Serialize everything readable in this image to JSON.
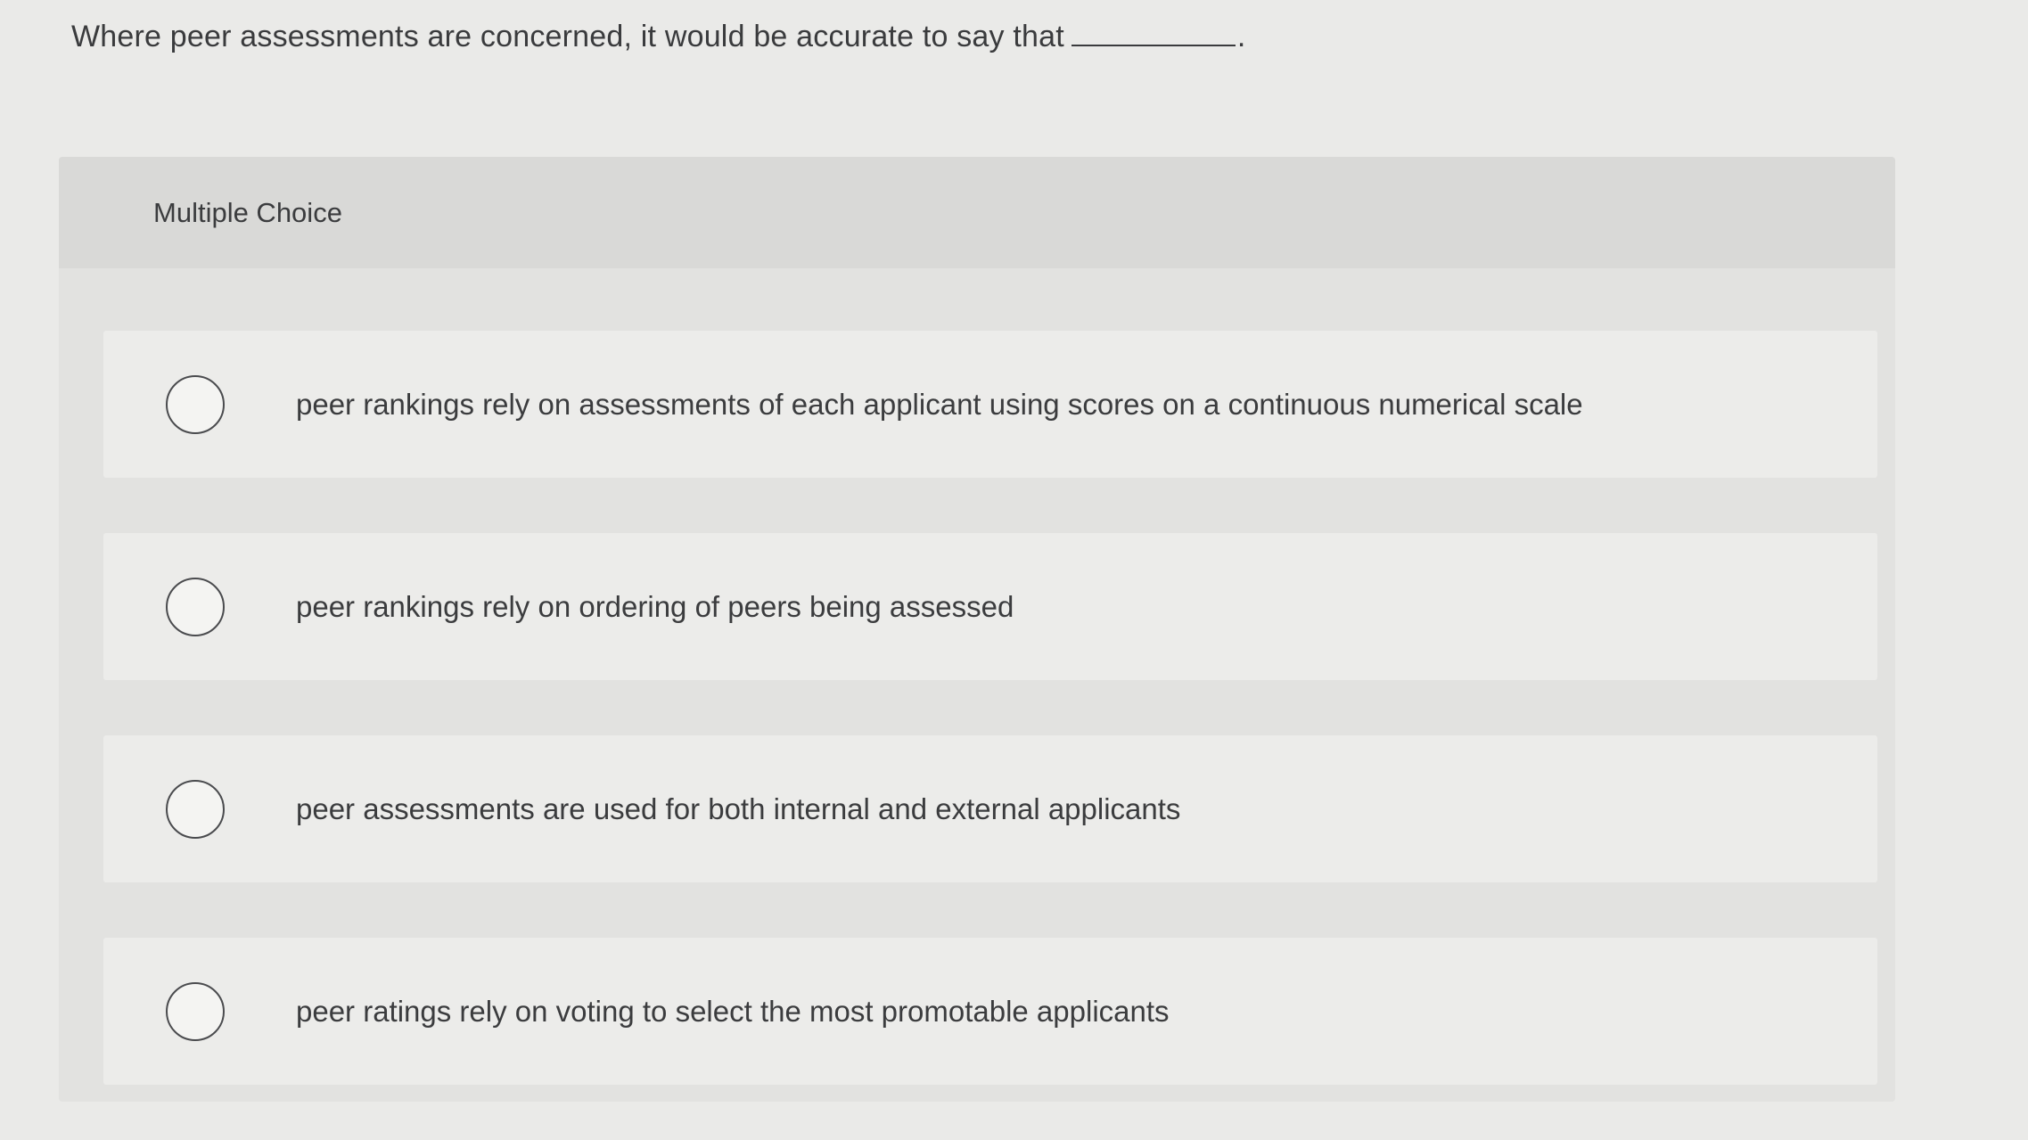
{
  "question": {
    "text": "Where peer assessments are concerned, it would be accurate to say that",
    "trailing": "."
  },
  "panel": {
    "header": "Multiple Choice"
  },
  "options": [
    {
      "label": "peer rankings rely on assessments of each applicant using scores on a continuous numerical scale",
      "selected": false
    },
    {
      "label": "peer rankings rely on ordering of peers being assessed",
      "selected": false
    },
    {
      "label": "peer assessments are used for both internal and external applicants",
      "selected": false
    },
    {
      "label": "peer ratings rely on voting to select the most promotable applicants",
      "selected": false
    }
  ]
}
